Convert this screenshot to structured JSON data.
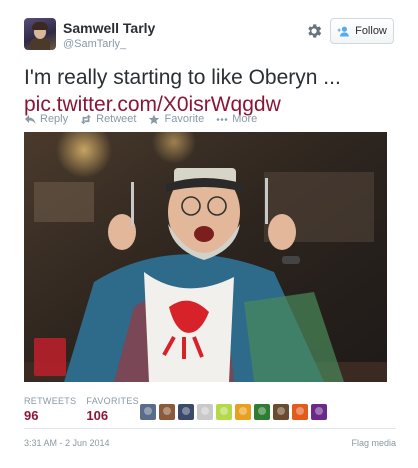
{
  "header": {
    "name": "Samwell Tarly",
    "handle": "@SamTarly_",
    "follow_label": "Follow"
  },
  "tweet": {
    "text": "I'm really starting to like Oberyn ...",
    "link": "pic.twitter.com/X0isrWqgdw"
  },
  "actions": [
    {
      "label": "Reply",
      "icon": "reply-icon"
    },
    {
      "label": "Retweet",
      "icon": "retweet-icon"
    },
    {
      "label": "Favorite",
      "icon": "star-icon"
    },
    {
      "label": "More",
      "icon": "more-dots-icon"
    }
  ],
  "stats": {
    "retweets_label": "RETWEETS",
    "retweets_value": "96",
    "favorites_label": "FAVORITES",
    "favorites_value": "106"
  },
  "favoriters": [
    {
      "icon": "favoriter-avatar-1",
      "color": "#5b6b8a"
    },
    {
      "icon": "favoriter-avatar-2",
      "color": "#8a5a3a"
    },
    {
      "icon": "favoriter-avatar-3",
      "color": "#3b4a6a"
    },
    {
      "icon": "favoriter-avatar-4",
      "color": "#c9c9c9"
    },
    {
      "icon": "favoriter-avatar-5",
      "color": "#b6d94c"
    },
    {
      "icon": "favoriter-avatar-6",
      "color": "#e8a020"
    },
    {
      "icon": "favoriter-avatar-7",
      "color": "#2e7d32"
    },
    {
      "icon": "favoriter-avatar-8",
      "color": "#6b4b2f"
    },
    {
      "icon": "favoriter-avatar-9",
      "color": "#e25a1c"
    },
    {
      "icon": "favoriter-avatar-10",
      "color": "#6a2a8a"
    }
  ],
  "footer": {
    "timestamp": "3:31 AM - 2 Jun 2014",
    "flag_label": "Flag media"
  },
  "colors": {
    "link": "#8a1538",
    "muted": "#8899a6",
    "text": "#292f33"
  }
}
